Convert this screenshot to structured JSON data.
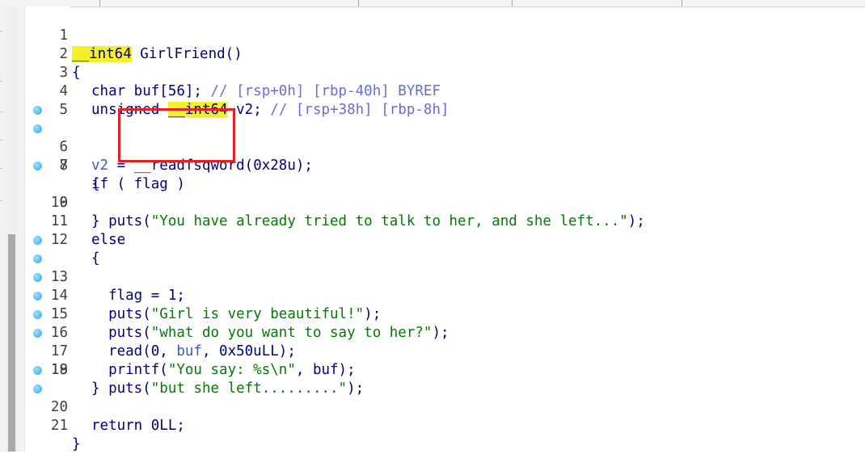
{
  "tabs": [
    "",
    "",
    "",
    ""
  ],
  "function": {
    "ret_type": "__int64",
    "name": " GirlFriend()"
  },
  "lines": {
    "1": {
      "num": "1"
    },
    "2": {
      "num": "2",
      "text": "{"
    },
    "3": {
      "num": "3",
      "a": "char buf[56]; ",
      "b": "// [rsp+0h] [rbp-40h] BYREF"
    },
    "4": {
      "num": "4",
      "a": "unsigned ",
      "b": "__int64",
      "c": " v2; ",
      "d": "// [rsp+38h] [rbp-8h]"
    },
    "5": {
      "num": "5"
    },
    "6": {
      "num": "6",
      "a": "v2",
      "b": " = __readfsqword(0x28u);"
    },
    "7": {
      "num": "7",
      "a": "if ( flag )"
    },
    "8": {
      "num": "8",
      "a": "{"
    },
    "9": {
      "num": "9",
      "a": "  puts(",
      "b": "\"You have already tried to talk to her, and she left...\"",
      "c": ");"
    },
    "10": {
      "num": "10",
      "a": "}"
    },
    "11": {
      "num": "11",
      "a": "else"
    },
    "12": {
      "num": "12",
      "a": "{"
    },
    "13": {
      "num": "13",
      "a": "  flag = 1;"
    },
    "14": {
      "num": "14",
      "a": "  puts(",
      "b": "\"Girl is very beautiful!\"",
      "c": ");"
    },
    "15": {
      "num": "15",
      "a": "  puts(",
      "b": "\"what do you want to say to her?\"",
      "c": ");"
    },
    "16": {
      "num": "16",
      "a": "  read(0, ",
      "b": "buf",
      "c": ", 0x50uLL);"
    },
    "17": {
      "num": "17",
      "a": "  printf(",
      "b": "\"You say: %s\\n\"",
      "c": ", buf);"
    },
    "18": {
      "num": "18",
      "a": "  puts(",
      "b": "\"but she left.........\"",
      "c": ");"
    },
    "19": {
      "num": "19",
      "a": "}"
    },
    "20": {
      "num": "20",
      "a": "return 0LL;"
    },
    "21": {
      "num": "21",
      "a": "}"
    }
  },
  "colors": {
    "highlight": "#f2ef2b",
    "string": "#067806",
    "keyword_text": "#000080",
    "comment": "#6b6bd6",
    "annotation_box": "#e0222a"
  }
}
